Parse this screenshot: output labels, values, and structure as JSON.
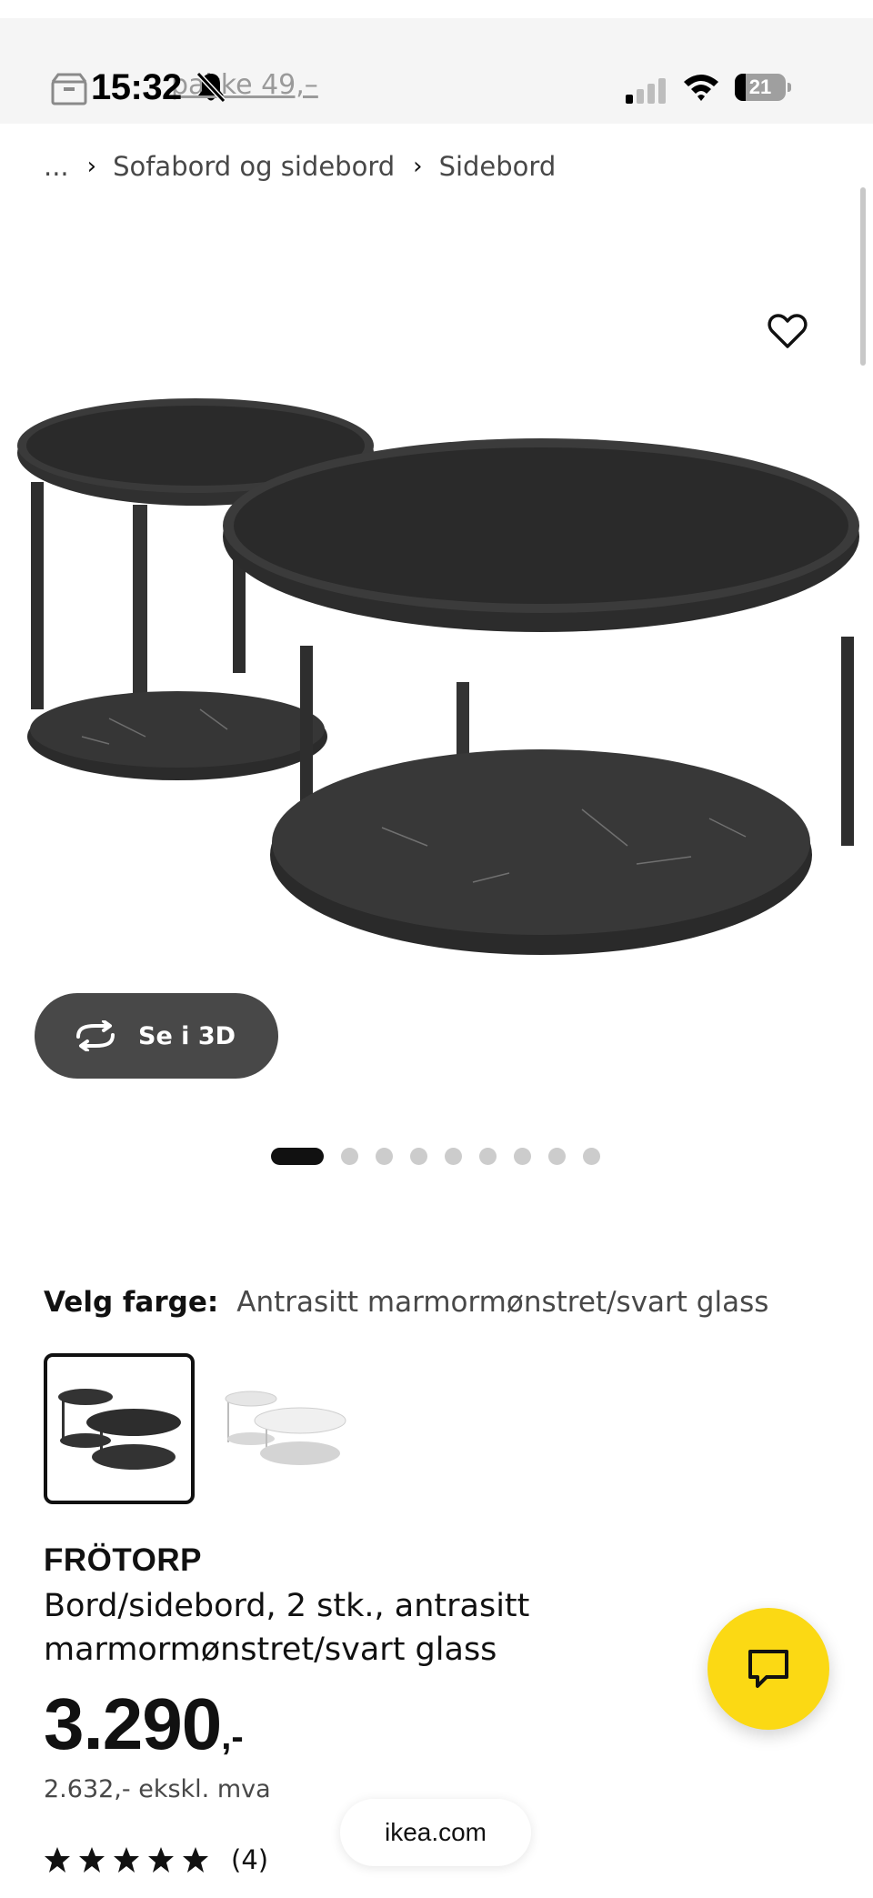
{
  "status_bar": {
    "time": "15:32",
    "ghost_text": "pakke 49,–",
    "battery_level": "21",
    "icons": [
      "box-icon",
      "bell-muted-icon",
      "signal-icon",
      "wifi-icon",
      "battery-icon"
    ]
  },
  "breadcrumb": {
    "ellipsis": "...",
    "separator": "›",
    "items": [
      "Sofabord og sidebord",
      "Sidebord"
    ]
  },
  "gallery": {
    "see_3d_label": "Se i 3D",
    "active_index": 0,
    "total_images": 9
  },
  "color_picker": {
    "label": "Velg farge:",
    "selected_value": "Antrasitt marmormønstret/svart glass",
    "options": [
      "anthracite",
      "white"
    ]
  },
  "product": {
    "name": "FRÖTORP",
    "description": "Bord/sidebord, 2 stk., antrasitt marmormønstret/svart glass",
    "price_main": "3.290",
    "price_suffix": ",-",
    "price_excl_vat": "2.632,- ekskl. mva",
    "rating_stars": 5,
    "rating_count": "(4)"
  },
  "browser": {
    "url": "ikea.com"
  },
  "colors": {
    "accent_yellow": "#FBD914",
    "dark_button": "#484848",
    "text": "#111111"
  }
}
